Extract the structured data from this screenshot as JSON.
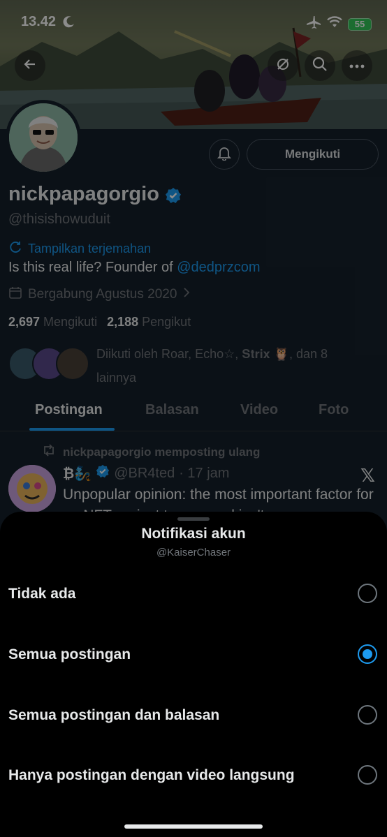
{
  "status_bar": {
    "time": "13.42",
    "battery": "55"
  },
  "profile": {
    "display_name": "nickpapagorgio",
    "handle": "@thisishowuduit",
    "translate_label": "Tampilkan terjemahan",
    "bio_prefix": "Is this real life? Founder of ",
    "bio_link": "@dedprzcom",
    "joined": "Bergabung Agustus 2020",
    "following_count": "2,697",
    "following_label": "Mengikuti",
    "followers_count": "2,188",
    "followers_label": "Pengikut",
    "followed_by": "Diikuti oleh Roar, Echo☆, 𝐒𝐭𝐫𝐢𝐱 🦉, dan 8 lainnya",
    "follow_button_label": "Mengikuti"
  },
  "tabs": [
    {
      "label": "Postingan",
      "active": true
    },
    {
      "label": "Balasan",
      "active": false
    },
    {
      "label": "Video",
      "active": false
    },
    {
      "label": "Foto",
      "active": false
    }
  ],
  "post": {
    "repost_label": "nickpapagorgio memposting ulang",
    "author_display": "₿🧞",
    "author_handle": "@BR4ted",
    "time": "· 17 jam",
    "text": "Unpopular opinion: the most important factor for an NFT project to succeed isn't"
  },
  "sheet": {
    "title": "Notifikasi akun",
    "subtitle": "@KaiserChaser",
    "options": [
      {
        "label": "Tidak ada",
        "selected": false
      },
      {
        "label": "Semua postingan",
        "selected": true
      },
      {
        "label": "Semua postingan dan balasan",
        "selected": false
      },
      {
        "label": "Hanya postingan dengan video langsung",
        "selected": false
      }
    ]
  },
  "colors": {
    "accent": "#1d9bf0",
    "sheet_bg": "#000000",
    "page_bg": "#15202b"
  }
}
